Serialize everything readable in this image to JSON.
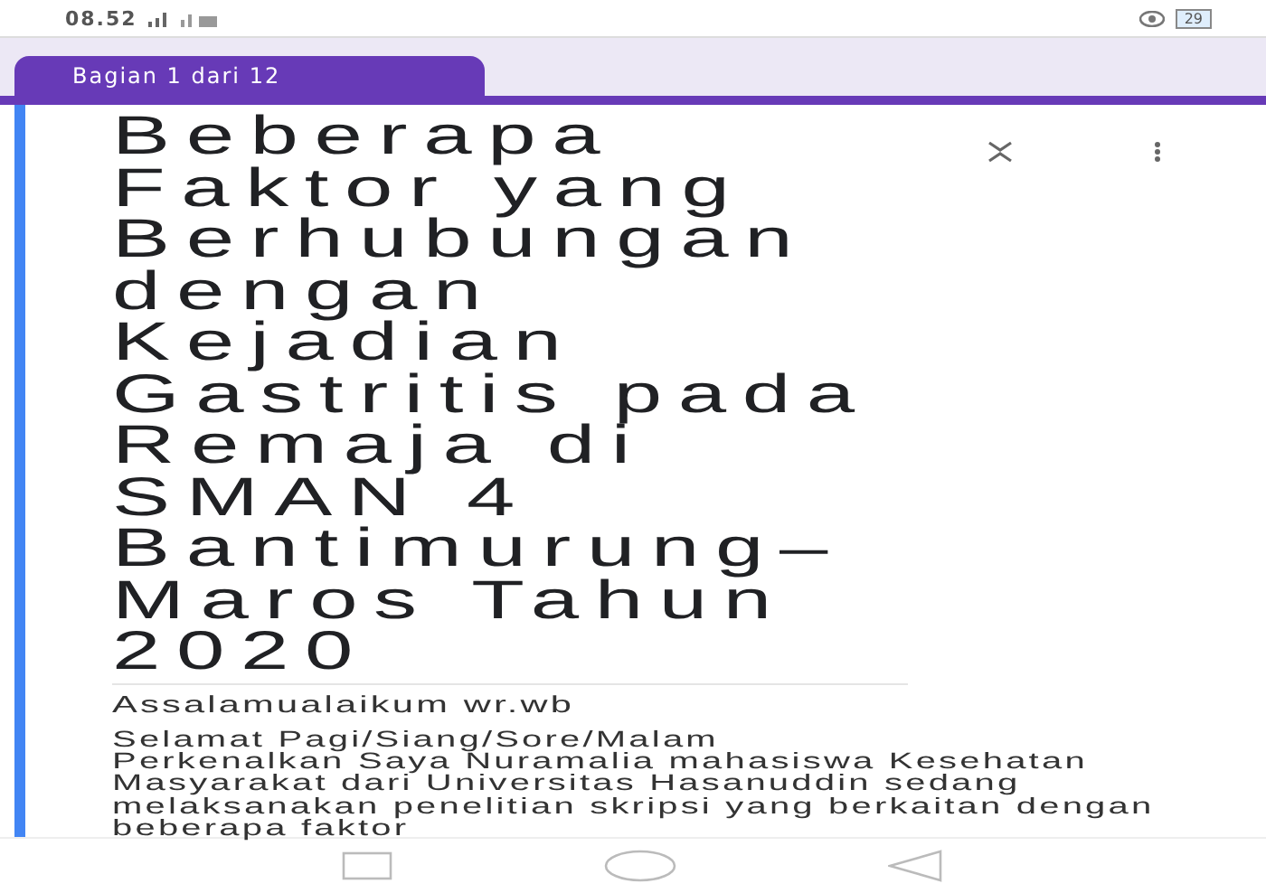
{
  "status_bar": {
    "time": "08.52",
    "battery": "29"
  },
  "section_tab": {
    "label": "Bagian 1 dari 12"
  },
  "form_header": {
    "title": "Beberapa Faktor yang Berhubungan dengan Kejadian Gastritis pada Remaja di SMAN 4 Bantimurung–Maros Tahun 2020",
    "greeting": "Assalamualaikum wr.wb",
    "description": "Selamat Pagi/Siang/Sore/Malam\nPerkenalkan Saya Nuramalia mahasiswa Kesehatan Masyarakat dari Universitas Hasanuddin sedang melaksanakan penelitian skripsi yang berkaitan dengan beberapa faktor"
  }
}
